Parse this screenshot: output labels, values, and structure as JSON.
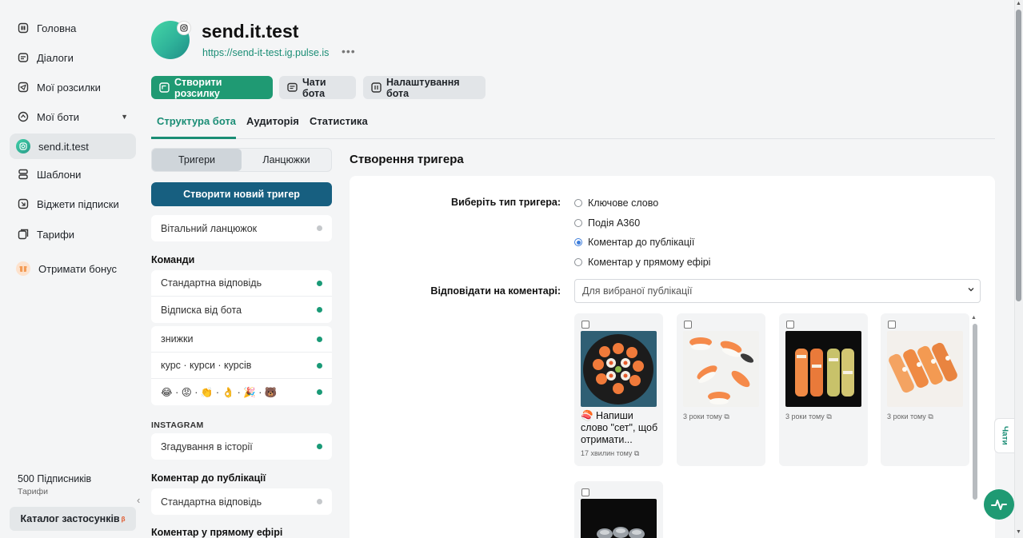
{
  "sidebar": {
    "items": [
      {
        "label": "Головна",
        "icon": "home-icon"
      },
      {
        "label": "Діалоги",
        "icon": "chat-icon"
      },
      {
        "label": "Мої розсилки",
        "icon": "send-icon"
      },
      {
        "label": "Мої боти",
        "icon": "bot-icon"
      },
      {
        "label": "send.it.test",
        "icon": "instagram-icon"
      },
      {
        "label": "Шаблони",
        "icon": "template-icon"
      },
      {
        "label": "Віджети підписки",
        "icon": "widget-icon"
      },
      {
        "label": "Тарифи",
        "icon": "tariff-icon"
      },
      {
        "label": "Отримати бонус",
        "icon": "gift-icon"
      }
    ],
    "subscribers": "500 Підписників",
    "tariff_link": "Тарифи",
    "catalog": "Каталог застосунків",
    "catalog_badge": "β"
  },
  "header": {
    "bot_name": "send.it.test",
    "bot_url": "https://send-it-test.ig.pulse.is",
    "more": "•••",
    "buttons": {
      "create_mailing": "Створити розсилку",
      "bot_chats": "Чати бота",
      "bot_settings": "Налаштування бота"
    },
    "tabs": [
      "Структура бота",
      "Аудиторія",
      "Статистика"
    ]
  },
  "triggers": {
    "segments": [
      "Тригери",
      "Ланцюжки"
    ],
    "new_trigger": "Створити новий тригер",
    "welcome": "Вітальний ланцюжок",
    "commands_title": "Команди",
    "commands_group1": [
      "Стандартна відповідь",
      "Відписка від бота"
    ],
    "commands_group2": [
      "знижки",
      "курс · курси · курсів",
      "😂 · 😡 · 👏 · 👌 · 🎉 · 🐻"
    ],
    "instagram_title": "INSTAGRAM",
    "instagram_items": [
      "Згадування в історії"
    ],
    "post_comment_title": "Коментар до публікації",
    "post_comment_items": [
      "Стандартна відповідь"
    ],
    "live_comment_title": "Коментар у прямому ефірі"
  },
  "create_trigger": {
    "title": "Створення тригера",
    "type_label": "Виберіть тип тригера:",
    "types": [
      "Ключове слово",
      "Подія A360",
      "Коментар до публікації",
      "Коментар у прямому ефірі"
    ],
    "selected_type": "Коментар до публікації",
    "reply_label": "Відповідати на коментарі:",
    "reply_value": "Для вибраної публікації",
    "posts": [
      {
        "caption": "🍣 Напиши слово \"сет\", щоб отримати...",
        "time": "17 хвилин тому"
      },
      {
        "time": "3 роки тому"
      },
      {
        "time": "3 роки тому"
      },
      {
        "time": "3 роки тому"
      }
    ]
  },
  "widgets": {
    "chats_tab": "Чати"
  }
}
